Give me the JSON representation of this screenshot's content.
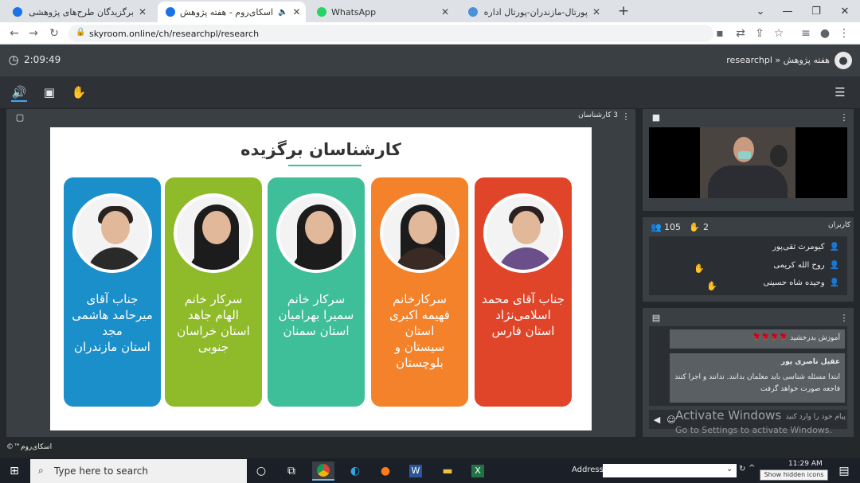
{
  "browser": {
    "tabs": [
      {
        "label": "برگزیدگان طرح‌های پژوهشی و فعالا",
        "favicon_color": "#1a73e8"
      },
      {
        "label": "اسکای‌روم - هفته پژوهش",
        "favicon_color": "#1a73e8"
      },
      {
        "label": "WhatsApp",
        "favicon_color": "#25d366"
      },
      {
        "label": "پورتال-مازندران-پورتال اداره کل کتابه",
        "favicon_color": "#4a90d9"
      }
    ],
    "new_tab": "+",
    "url": "skyroom.online/ch/researchpl/research"
  },
  "header": {
    "timer": "2:09:49",
    "breadcrumb": "researchpl » هفته پژوهش"
  },
  "presentation": {
    "count_label": "3 کارشناسان",
    "slide_title": "کارشناسان برگزیده",
    "cards": [
      {
        "lines": [
          "جناب آقای محمد",
          "اسلامی‌نژاد",
          "استان فارس"
        ],
        "color": "#e0452a",
        "gender": "m",
        "shirt": "#6a4f8a"
      },
      {
        "lines": [
          "سرکارخانم",
          "فهیمه اکبری",
          "استان",
          "سیستان و",
          "بلوچستان"
        ],
        "color": "#f4822b",
        "gender": "f",
        "shirt": "#3a2a25"
      },
      {
        "lines": [
          "سرکار خانم",
          "سمیرا بهرامیان",
          "استان سمنان"
        ],
        "color": "#3fbe9a",
        "gender": "f",
        "shirt": "#1c1c1c"
      },
      {
        "lines": [
          "سرکار خانم",
          "الهام جاهد",
          "استان خراسان",
          "جنوبی"
        ],
        "color": "#8fba2a",
        "gender": "f",
        "shirt": "#1c1c1c"
      },
      {
        "lines": [
          "جناب آقای",
          "میرحامد هاشمی",
          "مجد",
          "استان مازندران"
        ],
        "color": "#1a8fc9",
        "gender": "m",
        "shirt": "#2a2a2a"
      }
    ]
  },
  "users_panel": {
    "title": "کاربران",
    "user_count": "105",
    "hand_count": "2",
    "users": [
      "کیومرث تقی‌پور",
      "روح الله کریمی",
      "وحیده شاه حسینی"
    ]
  },
  "chat": {
    "msg1": "آموزش بدرخشید 🌹🌹🌹🌹",
    "sender": "عقیل ناصری پور",
    "msg2": "ابتدا مسئله شناسی باید معلمان بدانند. ندانند و اجرا کنند فاجعه صورت خواهد گرفت",
    "input_placeholder": "پیام خود را وارد کنید"
  },
  "watermark": {
    "title": "Activate Windows",
    "subtitle": "Go to Settings to activate Windows."
  },
  "footer": {
    "brand": "©™اسکای‌روم"
  },
  "taskbar": {
    "search_placeholder": "Type here to search",
    "address_label": "Address",
    "time": "11:29 AM",
    "hidden_icons_tooltip": "Show hidden icons"
  }
}
